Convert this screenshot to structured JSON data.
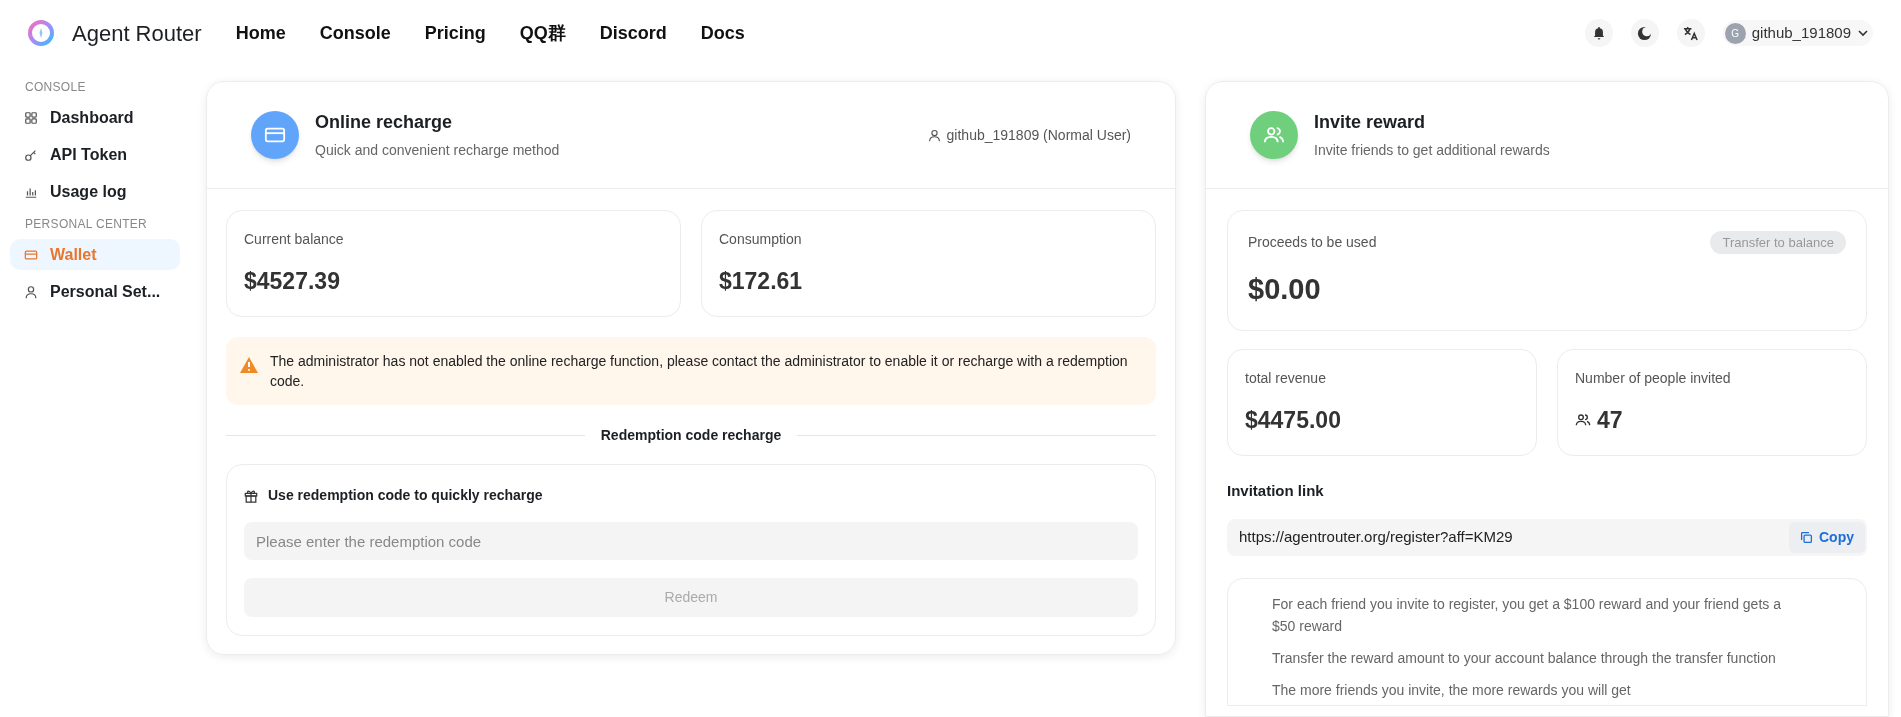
{
  "header": {
    "brand": "Agent Router",
    "nav": [
      {
        "label": "Home"
      },
      {
        "label": "Console"
      },
      {
        "label": "Pricing"
      },
      {
        "label": "QQ群"
      },
      {
        "label": "Discord"
      },
      {
        "label": "Docs"
      }
    ],
    "user": {
      "avatar": "G",
      "name": "github_191809"
    }
  },
  "sidebar": {
    "sections": [
      {
        "title": "CONSOLE",
        "items": [
          {
            "label": "Dashboard",
            "selected": false
          },
          {
            "label": "API Token",
            "selected": false
          },
          {
            "label": "Usage log",
            "selected": false
          }
        ]
      },
      {
        "title": "PERSONAL CENTER",
        "items": [
          {
            "label": "Wallet",
            "selected": true
          },
          {
            "label": "Personal Set...",
            "selected": false
          }
        ]
      }
    ]
  },
  "recharge": {
    "title": "Online recharge",
    "subtitle": "Quick and convenient recharge method",
    "user": "github_191809 (Normal User)",
    "stats": [
      {
        "label": "Current balance",
        "value": "$4527.39"
      },
      {
        "label": "Consumption",
        "value": "$172.61"
      }
    ],
    "warning": "The administrator has not enabled the online recharge function, please contact the administrator to enable it or recharge with a redemption code.",
    "divider_label": "Redemption code recharge",
    "redeem": {
      "title": "Use redemption code to quickly recharge",
      "placeholder": "Please enter the redemption code",
      "button": "Redeem",
      "button_disabled": true
    }
  },
  "invite": {
    "title": "Invite reward",
    "subtitle": "Invite friends to get additional rewards",
    "proceeds": {
      "label": "Proceeds to be used",
      "value": "$0.00",
      "button": "Transfer to balance",
      "button_disabled": true
    },
    "stats": [
      {
        "label": "total revenue",
        "value": "$4475.00"
      },
      {
        "label": "Number of people invited",
        "value": "47"
      }
    ],
    "link_label": "Invitation link",
    "link": "https://agentrouter.org/register?aff=KM29",
    "copy": "Copy",
    "notes": [
      "For each friend you invite to register, you get a $100 reward and your friend gets a $50 reward",
      "Transfer the reward amount to your account balance through the transfer function",
      "The more friends you invite, the more rewards you will get"
    ]
  }
}
